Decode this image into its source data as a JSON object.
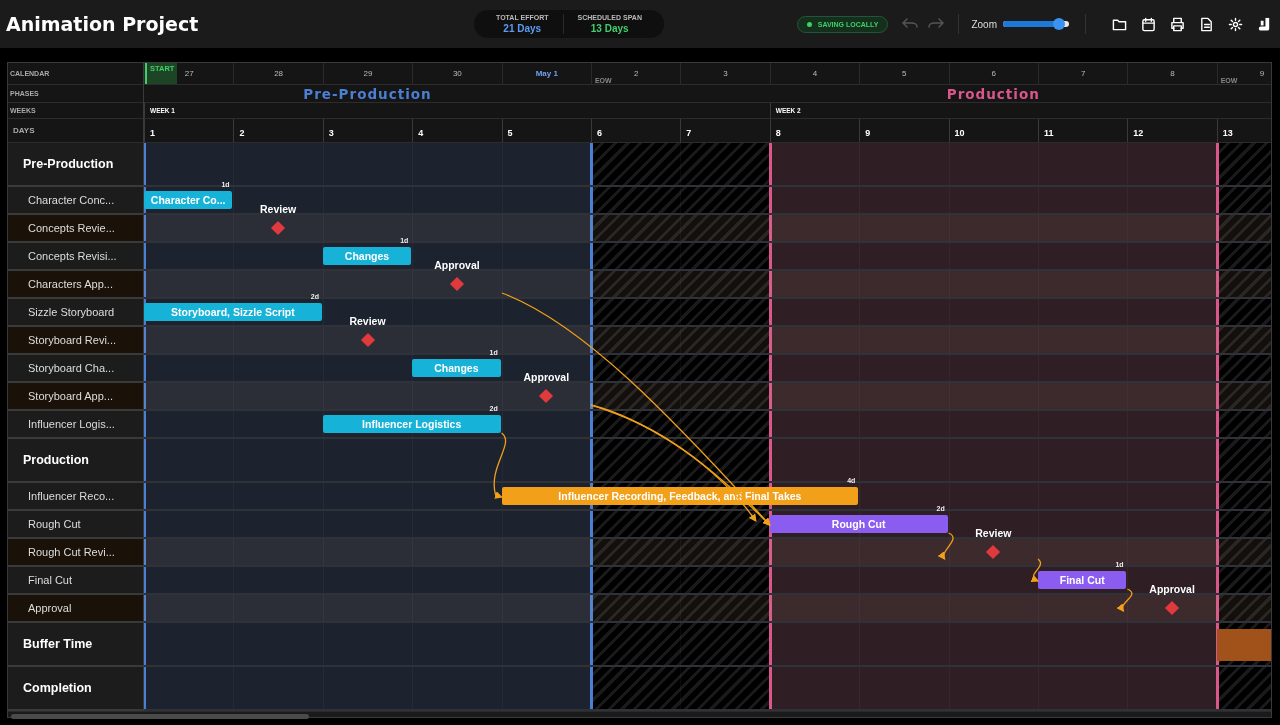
{
  "title": "Animation Project",
  "summary": [
    {
      "label": "TOTAL EFFORT",
      "value": "21 Days",
      "color": "#5b9cf0"
    },
    {
      "label": "SCHEDULED SPAN",
      "value": "13 Days",
      "color": "#3ecf6a"
    }
  ],
  "toolbar": {
    "status": "SAVING LOCALLY",
    "undo": {
      "disabled": true
    },
    "redo": {
      "disabled": true
    },
    "zoom": {
      "label": "Zoom",
      "level": 0.85
    }
  },
  "header_labels": [
    "CALENDAR",
    "PHASES",
    "WEEKS",
    "DAYS"
  ],
  "calendar": [
    {
      "label": "27",
      "month_start": false,
      "tag": {
        "kind": "start",
        "label": "START"
      }
    },
    {
      "label": "28",
      "month_start": false
    },
    {
      "label": "29",
      "month_start": false
    },
    {
      "label": "30",
      "month_start": false
    },
    {
      "label": "May 1",
      "month_start": true
    },
    {
      "label": "2",
      "month_start": false,
      "tag": {
        "kind": "eow",
        "label": "EOW"
      }
    },
    {
      "label": "3",
      "month_start": false
    },
    {
      "label": "4",
      "month_start": false
    },
    {
      "label": "5",
      "month_start": false
    },
    {
      "label": "6",
      "month_start": false
    },
    {
      "label": "7",
      "month_start": false
    },
    {
      "label": "8",
      "month_start": false
    },
    {
      "label": "9",
      "month_start": false,
      "tag": {
        "kind": "eow",
        "label": "EOW"
      }
    }
  ],
  "phases": [
    {
      "label": "Pre-Production",
      "color": "#4a7fd4"
    },
    {
      "label": "Production",
      "color": "#d9578a"
    }
  ],
  "weeks": [
    {
      "label": "WEEK 1"
    },
    {
      "label": "WEEK 2"
    }
  ],
  "days": [
    {
      "label": "1",
      "weekend": false
    },
    {
      "label": "2",
      "weekend": false
    },
    {
      "label": "3",
      "weekend": false
    },
    {
      "label": "4",
      "weekend": false
    },
    {
      "label": "5",
      "weekend": false
    },
    {
      "label": "6",
      "weekend": true
    },
    {
      "label": "7",
      "weekend": true
    },
    {
      "label": "8",
      "weekend": false
    },
    {
      "label": "9",
      "weekend": false
    },
    {
      "label": "10",
      "weekend": false
    },
    {
      "label": "11",
      "weekend": false
    },
    {
      "label": "12",
      "weekend": false
    },
    {
      "label": "13",
      "weekend": true
    }
  ],
  "rows": [
    {
      "kind": "group",
      "label": "Pre-Production"
    },
    {
      "kind": "task",
      "label": "Character Conc...",
      "bar": {
        "label": "Character Co...",
        "duration": "1d",
        "color": "#16b2d8"
      }
    },
    {
      "kind": "milestone",
      "label": "Concepts Revie...",
      "milestone": {
        "label": "Review"
      }
    },
    {
      "kind": "task",
      "label": "Concepts Revisi...",
      "bar": {
        "label": "Changes",
        "duration": "1d",
        "color": "#16b2d8"
      }
    },
    {
      "kind": "milestone",
      "label": "Characters App...",
      "milestone": {
        "label": "Approval"
      }
    },
    {
      "kind": "task",
      "label": "Sizzle Storyboard",
      "bar": {
        "label": "Storyboard, Sizzle Script",
        "duration": "2d",
        "color": "#16b2d8"
      }
    },
    {
      "kind": "milestone",
      "label": "Storyboard Revi...",
      "milestone": {
        "label": "Review"
      }
    },
    {
      "kind": "task",
      "label": "Storyboard Cha...",
      "bar": {
        "label": "Changes",
        "duration": "1d",
        "color": "#16b2d8"
      }
    },
    {
      "kind": "milestone",
      "label": "Storyboard App...",
      "milestone": {
        "label": "Approval"
      }
    },
    {
      "kind": "task",
      "label": "Influencer Logis...",
      "bar": {
        "label": "Influencer Logistics",
        "duration": "2d",
        "color": "#16b2d8"
      }
    },
    {
      "kind": "group",
      "label": "Production"
    },
    {
      "kind": "task",
      "label": "Influencer Reco...",
      "bar": {
        "label": "Influencer Recording, Feedback, and Final Takes",
        "duration": "4d",
        "color": "#f2a01a"
      }
    },
    {
      "kind": "task",
      "label": "Rough Cut",
      "bar": {
        "label": "Rough Cut",
        "duration": "2d",
        "color": "#8b5cf0"
      }
    },
    {
      "kind": "milestone",
      "label": "Rough Cut Revi...",
      "milestone": {
        "label": "Review"
      }
    },
    {
      "kind": "task",
      "label": "Final Cut",
      "bar": {
        "label": "Final Cut",
        "duration": "1d",
        "color": "#8b5cf0"
      }
    },
    {
      "kind": "milestone",
      "label": "Approval",
      "milestone": {
        "label": "Approval"
      }
    },
    {
      "kind": "group",
      "label": "Buffer Time",
      "block": {
        "color": "#a0521a"
      }
    },
    {
      "kind": "group",
      "label": "Completion"
    }
  ]
}
